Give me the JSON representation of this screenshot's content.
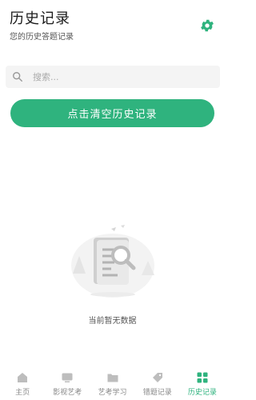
{
  "header": {
    "title": "历史记录",
    "subtitle": "您的历史答题记录"
  },
  "search": {
    "placeholder": "搜索..."
  },
  "clear_button": {
    "label": "点击清空历史记录"
  },
  "empty_state": {
    "text": "当前暂无数据"
  },
  "tabbar": {
    "items": [
      {
        "label": "主页",
        "icon": "home-icon"
      },
      {
        "label": "影视艺考",
        "icon": "tv-icon"
      },
      {
        "label": "艺考学习",
        "icon": "folder-icon"
      },
      {
        "label": "错题记录",
        "icon": "tag-icon"
      },
      {
        "label": "历史记录",
        "icon": "grid-icon",
        "active": true
      }
    ]
  },
  "colors": {
    "accent": "#2fb37e",
    "inactive": "#bdbdbd"
  }
}
